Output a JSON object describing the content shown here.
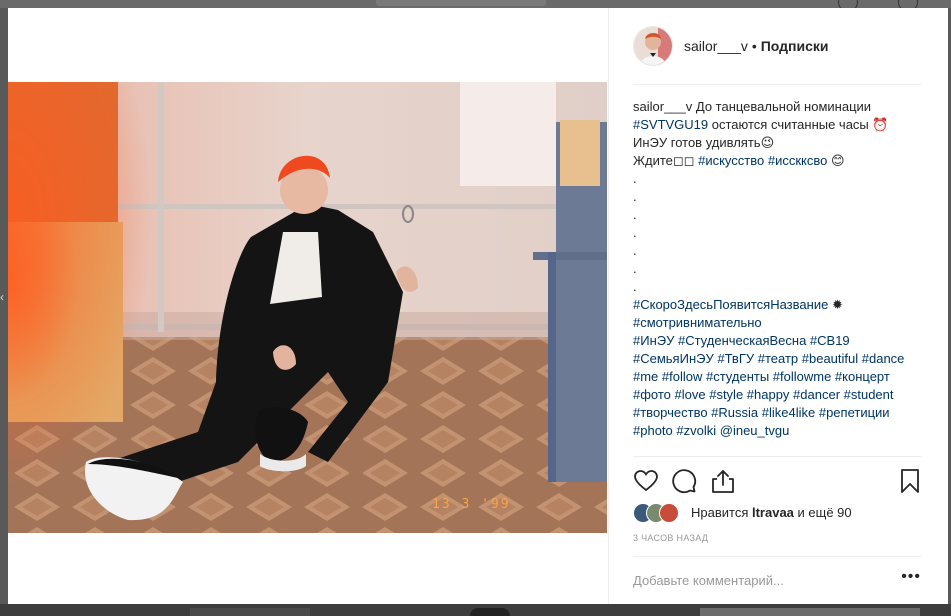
{
  "post": {
    "username": "sailor___v",
    "separator": "•",
    "follow_label": "Подписки",
    "photo_date_stamp": "13 3 '99"
  },
  "caption": {
    "username": "sailor___v",
    "text_1": " До танцевальной номинации",
    "tag_svtvgu19": "#SVTVGU19",
    "text_2": " остаются считанные часы ⏰",
    "text_3": "ИнЭУ готов удивлять😉",
    "text_4": "Ждите",
    "text_4b": "◻◻",
    "tag_art": "#искусство",
    "tag_artt": "#исскксво",
    "emoji_smile": "😊",
    "dot": ".",
    "tags_line_1": "#СкороЗдесьПоявитсяНазвание",
    "burst": "✹",
    "tags_line_2": "#смотривнимательно",
    "tags_line_3": "#ИнЭУ #СтуденческаяВесна #СВ19",
    "tags_line_4": "#СемьяИнЭУ #ТвГУ #театр #beautiful #dance",
    "tags_line_5": "#me #follow #студенты #followme #концерт",
    "tags_line_6": "#фото #love #style #happy #dancer #student",
    "tags_line_7": "#творчество #Russia #like4like #репетиции",
    "tags_line_8_tags": "#photo #zvolki",
    "tags_line_8_mention": "@ineu_tvgu"
  },
  "icons": {
    "like": "heart-icon",
    "comment": "comment-icon",
    "share": "share-icon",
    "save": "bookmark-icon",
    "more": "more-options-icon"
  },
  "likes": {
    "prefix": "Нравится ",
    "user": "ltravaa",
    "suffix": " и ещё 90"
  },
  "timestamp": "3 часов назад",
  "comment_placeholder": "Добавьте комментарий...",
  "more_label": "•••",
  "colors": {
    "link": "#003569",
    "text": "#262626",
    "muted": "#999999",
    "border": "#efefef",
    "overlay": "#595959"
  }
}
